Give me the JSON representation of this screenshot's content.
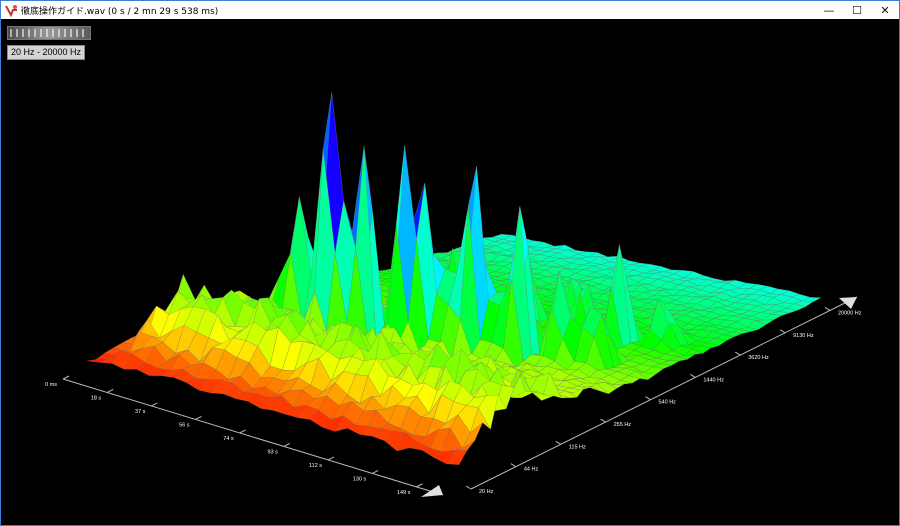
{
  "window": {
    "title": "徹底操作ガイド.wav (0 s / 2 mn 29 s 538 ms)",
    "controls": {
      "minimize": "—",
      "maximize": "☐",
      "close": "✕"
    }
  },
  "toolbar": {
    "zoom_slider": "zoom-slider",
    "frequency_range_button": "20 Hz - 20000 Hz"
  },
  "chart_data": {
    "type": "surface",
    "time_axis": {
      "ticks": [
        "0 ms",
        "18 s",
        "37 s",
        "56 s",
        "74 s",
        "93 s",
        "112 s",
        "130 s",
        "149 s"
      ]
    },
    "frequency_axis": {
      "ticks": [
        "20 Hz",
        "44 Hz",
        "115 Hz",
        "255 Hz",
        "540 Hz",
        "1440 Hz",
        "3620 Hz",
        "9130 Hz",
        "20000 Hz"
      ],
      "scale": "log"
    },
    "colormap": [
      "#ff0000",
      "#ff8000",
      "#ffff00",
      "#00ff00",
      "#00ffff",
      "#0000ff",
      "#ff00ff"
    ],
    "background": "#000000"
  }
}
